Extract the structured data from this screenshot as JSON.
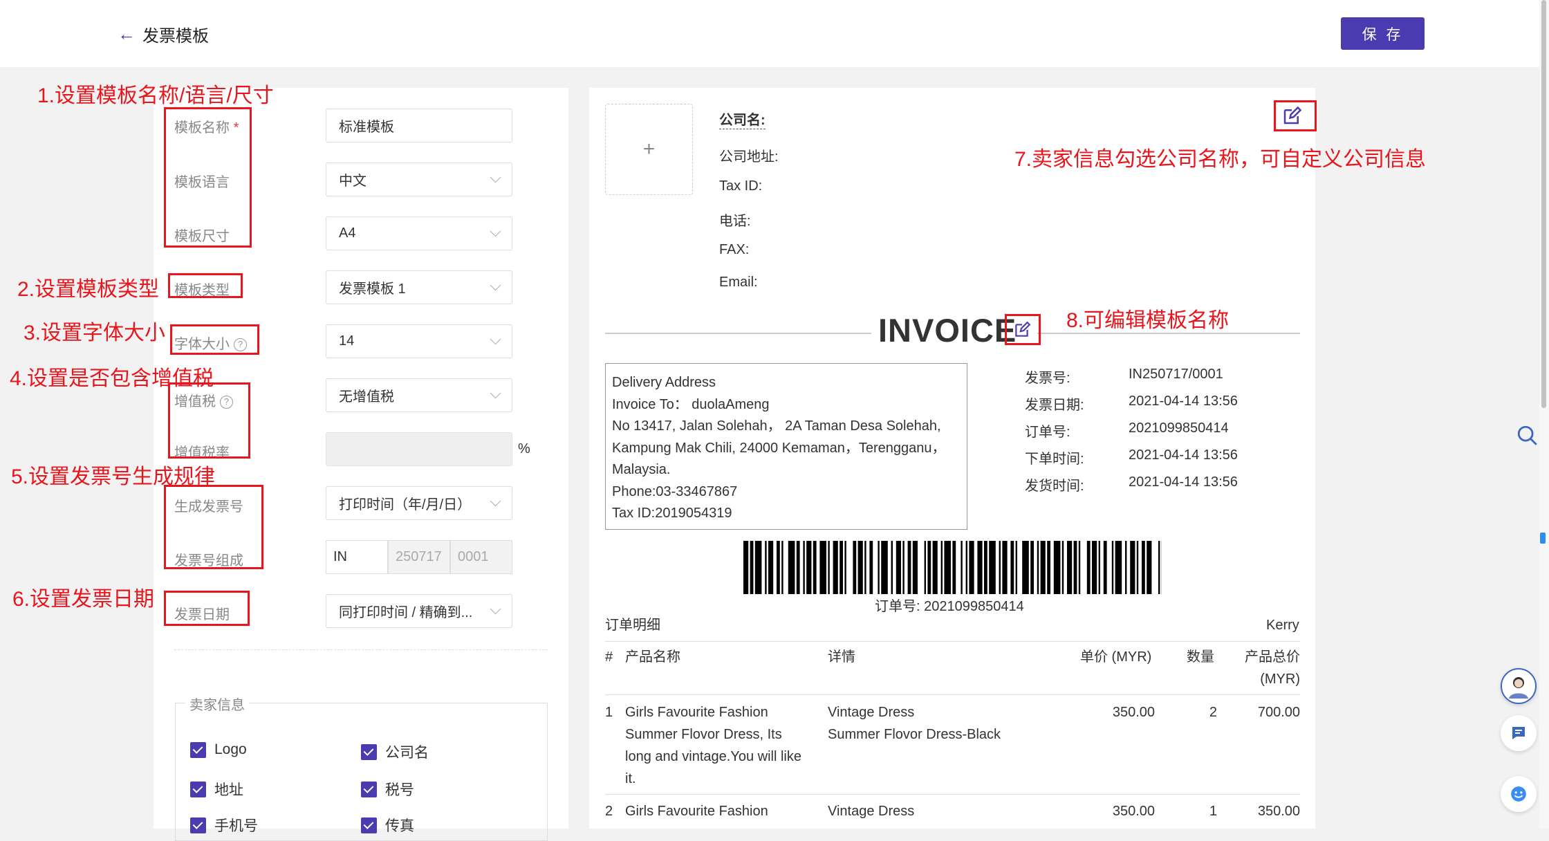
{
  "header": {
    "back_label": "发票模板",
    "save_label": "保 存"
  },
  "form": {
    "template_name": {
      "label": "模板名称",
      "required_mark": "*",
      "value": "标准模板"
    },
    "template_language": {
      "label": "模板语言",
      "value": "中文"
    },
    "template_size": {
      "label": "模板尺寸",
      "value": "A4"
    },
    "template_type": {
      "label": "模板类型",
      "value": "发票模板 1"
    },
    "font_size": {
      "label": "字体大小",
      "value": "14"
    },
    "vat": {
      "label": "增值税",
      "value": "无增值税"
    },
    "vat_rate": {
      "label": "增值税率",
      "unit": "%"
    },
    "gen_invoice_no": {
      "label": "生成发票号",
      "value": "打印时间（年/月/日）"
    },
    "invoice_no_format": {
      "label": "发票号组成",
      "prefix": "IN",
      "date_part": "250717",
      "seq_part": "0001"
    },
    "invoice_date": {
      "label": "发票日期",
      "value": "同打印时间 / 精确到..."
    }
  },
  "seller_info": {
    "legend": "卖家信息",
    "options": [
      {
        "label": "Logo",
        "checked": true
      },
      {
        "label": "公司名",
        "checked": true
      },
      {
        "label": "地址",
        "checked": true
      },
      {
        "label": "税号",
        "checked": true
      },
      {
        "label": "手机号",
        "checked": true
      },
      {
        "label": "传真",
        "checked": true
      }
    ]
  },
  "annotations": [
    "1.设置模板名称/语言/尺寸",
    "2.设置模板类型",
    "3.设置字体大小",
    "4.设置是否包含增值税",
    "5.设置发票号生成规律",
    "6.设置发票日期",
    "7.卖家信息勾选公司名称，可自定义公司信息",
    "8.可编辑模板名称"
  ],
  "preview": {
    "upload_symbol": "+",
    "company": {
      "name_label": "公司名:",
      "address_label": "公司地址:",
      "taxid_label": "Tax ID:",
      "phone_label": "电话:",
      "fax_label": "FAX:",
      "email_label": "Email:"
    },
    "title": "INVOICE",
    "address_lines": [
      "Delivery Address",
      "Invoice To： duolaAmeng",
      "No 13417, Jalan Solehah， 2A Taman Desa Solehah,",
      "Kampung Mak Chili, 24000 Kemaman，Terengganu，",
      "Malaysia.",
      "Phone:03-33467867",
      "Tax ID:2019054319"
    ],
    "meta": [
      {
        "label": "发票号:",
        "value": "IN250717/0001"
      },
      {
        "label": "发票日期:",
        "value": "2021-04-14 13:56"
      },
      {
        "label": "订单号:",
        "value": "2021099850414"
      },
      {
        "label": "下单时间:",
        "value": "2021-04-14 13:56"
      },
      {
        "label": "发货时间:",
        "value": "2021-04-14 13:56"
      }
    ],
    "barcode_label": "订单号: 2021099850414",
    "order_detail_label": "订单明细",
    "carrier": "Kerry",
    "table_headers": {
      "num": "#",
      "product": "产品名称",
      "detail": "详情",
      "unit_price": "单价 (MYR)",
      "qty": "数量",
      "total_1": "产品总价",
      "total_2": "(MYR)"
    },
    "rows": [
      {
        "num": "1",
        "product_lines": [
          "Girls Favourite Fashion",
          "Summer Flovor Dress, Its",
          "long and vintage.You will like",
          "it."
        ],
        "detail_lines": [
          "Vintage Dress",
          "Summer Flovor Dress-Black"
        ],
        "price": "350.00",
        "qty": "2",
        "total": "700.00"
      },
      {
        "num": "2",
        "product_lines": [
          "Girls Favourite Fashion"
        ],
        "detail_lines": [
          "Vintage Dress"
        ],
        "price": "350.00",
        "qty": "1",
        "total": "350.00"
      }
    ]
  }
}
